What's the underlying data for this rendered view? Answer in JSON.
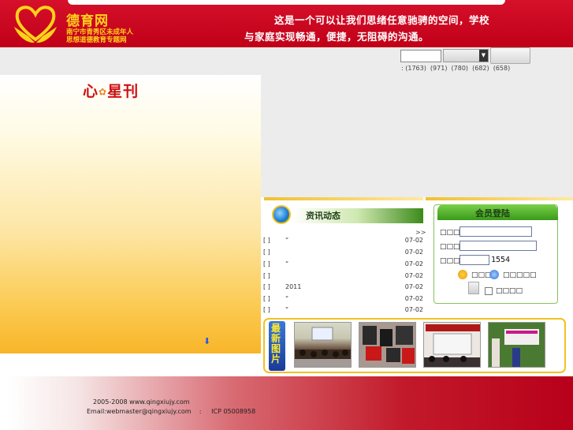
{
  "header": {
    "logo_title": "德育网",
    "logo_subtitle_line1": "南宁市青秀区未成年人",
    "logo_subtitle_line2": "思想道德教育专题网",
    "slogan_line1": "这是一个可以让我们思绪任意驰骋的空间，学校",
    "slogan_line2": "与家庭实现畅通，便捷，无阻碍的沟通。",
    "brand_color": "#c8001e",
    "accent_color": "#ffd21a"
  },
  "search": {
    "counts": ": (1763)  (971)  (780)  (682)  (658)"
  },
  "magazine": {
    "title_part1": "心",
    "flower_glyph": "✿",
    "title_part2": "星刊",
    "arrow_glyph": "⬇"
  },
  "news": {
    "title": "资讯动态",
    "more": ">>",
    "items": [
      {
        "bracket": "[  ]",
        "title": "“",
        "date": "07-02"
      },
      {
        "bracket": "[  ]",
        "title": "",
        "date": "07-02"
      },
      {
        "bracket": "[  ]",
        "title": "“",
        "date": "07-02"
      },
      {
        "bracket": "[  ]",
        "title": "",
        "date": "07-02"
      },
      {
        "bracket": "[  ]",
        "title": "2011",
        "date": "07-02"
      },
      {
        "bracket": "[  ]",
        "title": "“",
        "date": "07-02"
      },
      {
        "bracket": "[  ]",
        "title": "“",
        "date": "07-02"
      }
    ]
  },
  "login": {
    "title": "会员登陆",
    "username_label": "□□□□",
    "password_label": "□□□□",
    "code_label": "□□□□",
    "code_value": "1554",
    "register_link": "□□□□",
    "forgot_link": "□□□□□",
    "remember_label": "□□□□"
  },
  "photos": {
    "tag": "最新图片",
    "images": [
      "classroom-photo",
      "protest-photo",
      "presentation-photo",
      "outdoor-event-photo"
    ]
  },
  "footer": {
    "copyright": "2005-2008 www.qingxiujy.com",
    "contact": "Email:webmaster@qingxiujy.com    :     ICP 05008958"
  }
}
